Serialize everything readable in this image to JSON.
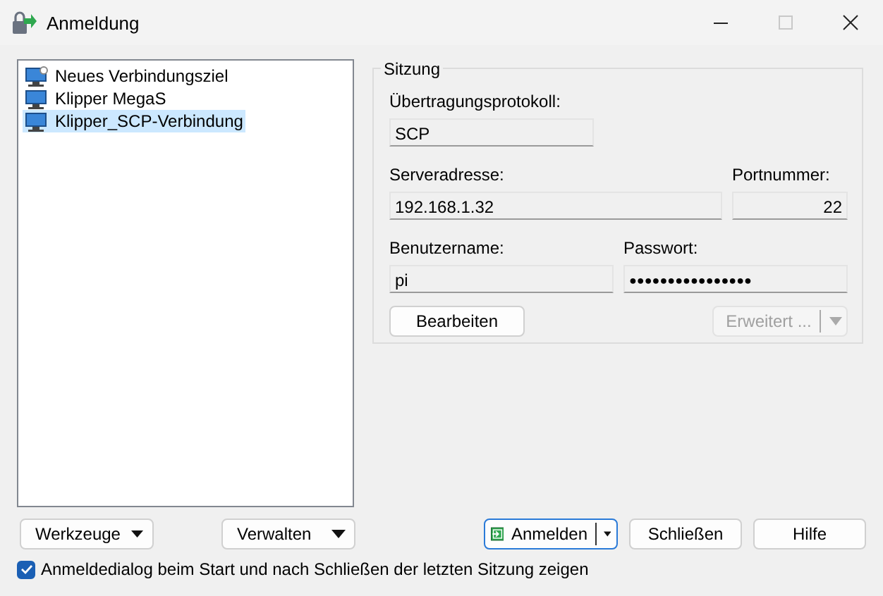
{
  "window": {
    "title": "Anmeldung",
    "controls": [
      {
        "kind": "minimize",
        "disabled": false
      },
      {
        "kind": "maximize",
        "disabled": true
      },
      {
        "kind": "close",
        "disabled": false
      }
    ]
  },
  "sites": [
    {
      "kind": "new",
      "label": "Neues Verbindungsziel",
      "selected": false
    },
    {
      "kind": "site",
      "label": "Klipper MegaS",
      "selected": false
    },
    {
      "kind": "site",
      "label": "Klipper_SCP-Verbindung",
      "selected": true
    }
  ],
  "session": {
    "title": "Sitzung",
    "protocol": {
      "label": "Übertragungsprotokoll:",
      "value": "SCP"
    },
    "host": {
      "label": "Serveradresse:",
      "value": "192.168.1.32"
    },
    "port": {
      "label": "Portnummer:",
      "value": "22"
    },
    "user": {
      "label": "Benutzername:",
      "value": "pi"
    },
    "password": {
      "label": "Passwort:",
      "value": "●●●●●●●●●●●●●●●●"
    },
    "edit_button": {
      "label": "Bearbeiten"
    },
    "advanced_button": {
      "label": "Erweitert ...",
      "disabled": true
    }
  },
  "tools_buttons": [
    {
      "label": "Werkzeuge"
    },
    {
      "label": "Verwalten"
    }
  ],
  "action_buttons": [
    {
      "kind": "split",
      "label": "Anmelden",
      "default": true
    },
    {
      "kind": "plain",
      "label": "Schließen",
      "default": false
    },
    {
      "kind": "plain",
      "label": "Hilfe",
      "default": false
    }
  ],
  "show_on_startup": {
    "label": "Anmeldedialog beim Start und nach Schließen der letzten Sitzung zeigen",
    "checked": true
  }
}
